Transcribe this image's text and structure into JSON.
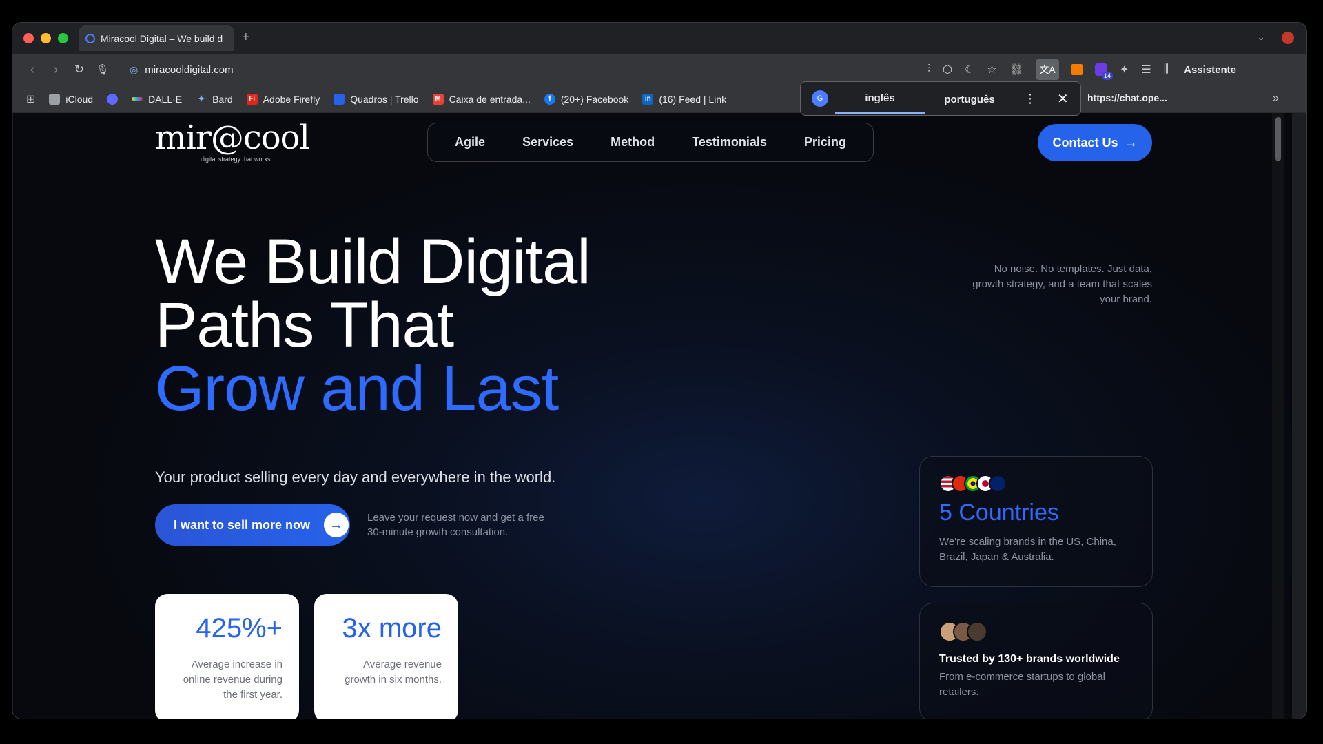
{
  "browser": {
    "tab_title": "Miracool Digital – We build d",
    "url": "miracooldigital.com",
    "assistant_label": "Assistente",
    "extension_badge": "14",
    "bookmarks": [
      {
        "label": "iCloud",
        "icon": "apple-icon",
        "color": "#9aa0a6"
      },
      {
        "label": "",
        "icon": "openai-icon",
        "color": "#5b6bff"
      },
      {
        "label": "DALL·E",
        "icon": "dalle-icon",
        "color": "#f4c542"
      },
      {
        "label": "Bard",
        "icon": "bard-icon",
        "color": "#4a90e2"
      },
      {
        "label": "Adobe Firefly",
        "icon": "adobe-icon",
        "color": "#e1251b"
      },
      {
        "label": "Quadros | Trello",
        "icon": "trello-icon",
        "color": "#2563eb"
      },
      {
        "label": "Caixa de entrada...",
        "icon": "gmail-icon",
        "color": "#ea4335"
      },
      {
        "label": "(20+) Facebook",
        "icon": "facebook-icon",
        "color": "#1877f2"
      },
      {
        "label": "(16) Feed | Link",
        "icon": "linkedin-icon",
        "color": "#0a66c2"
      }
    ],
    "chat_bookmark": "https://chat.ope...",
    "translate": {
      "lang_from": "inglês",
      "lang_to": "português"
    }
  },
  "site": {
    "logo_word": "mir@cool",
    "logo_tagline": "digital strategy that works",
    "nav": [
      "Agile",
      "Services",
      "Method",
      "Testimonials",
      "Pricing"
    ],
    "contact_label": "Contact Us",
    "hero": {
      "line1": "We Build Digital",
      "line2": "Paths That",
      "line3": "Grow and Last",
      "subtitle": "Your product selling every day and everywhere in the world.",
      "aside": "No noise. No templates. Just data, growth strategy, and a team that scales your brand.",
      "cta_label": "I want to sell more now",
      "cta_note": "Leave your request now and get a free 30-minute growth consultation."
    },
    "stats": [
      {
        "value": "425%+",
        "desc": "Average increase in online revenue during the first year."
      },
      {
        "value": "3x more",
        "desc": "Average revenue growth in six months."
      }
    ],
    "countries_card": {
      "title": "5 Countries",
      "text": "We're scaling brands in the US, China, Brazil, Japan & Australia."
    },
    "trusted_card": {
      "title": "Trusted by 130+ brands worldwide",
      "text": "From e-commerce startups to global retailers."
    },
    "accent_color": "#2563eb"
  }
}
